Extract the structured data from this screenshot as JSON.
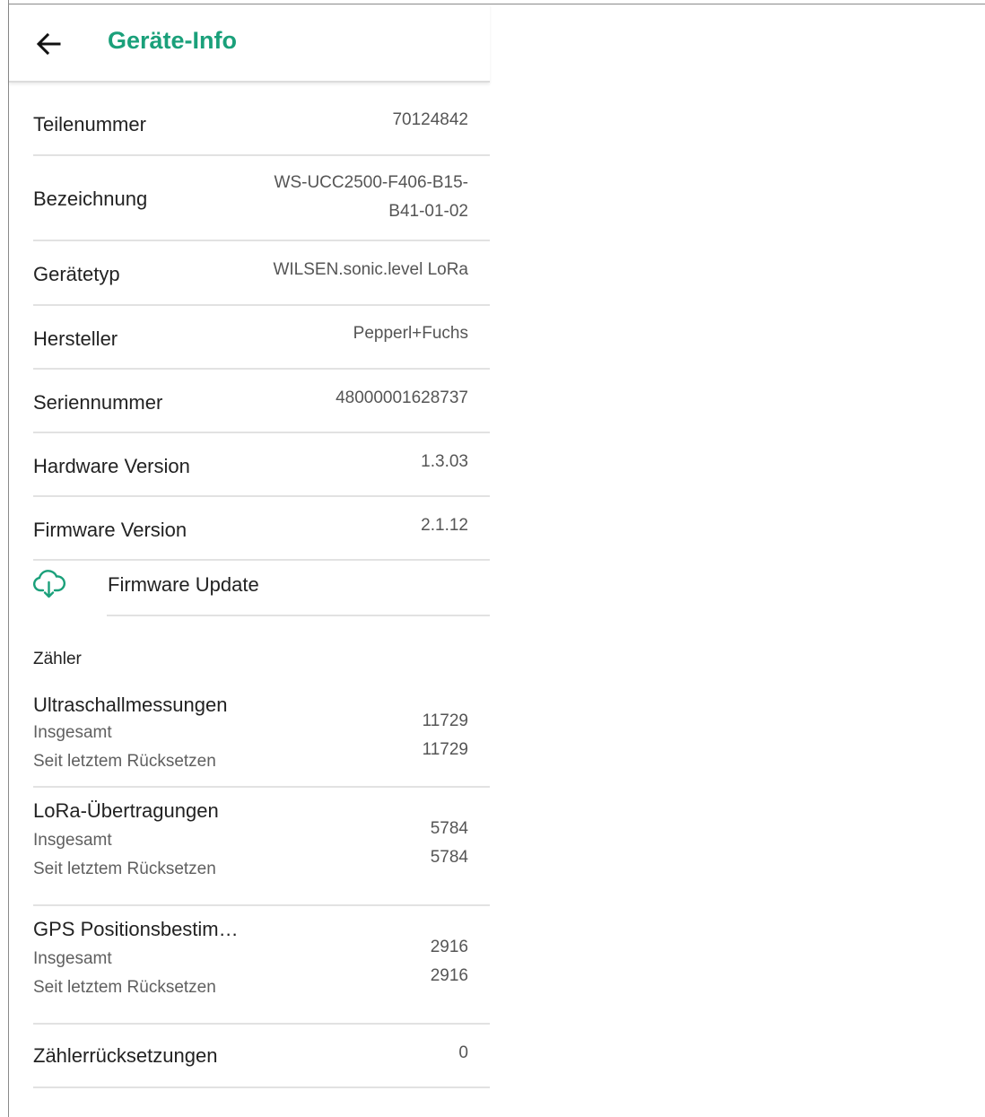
{
  "appbar": {
    "title": "Geräte-Info",
    "back_icon": "arrow-left-icon",
    "accent_color": "#1aa07a"
  },
  "info_rows": [
    {
      "label": "Teilenummer",
      "value_line1": "70124842",
      "value_line2": ""
    },
    {
      "label": "Bezeichnung",
      "value_line1": "WS-UCC2500-F406-B15-",
      "value_line2": "B41-01-02"
    },
    {
      "label": "Gerätetyp",
      "value_line1": "WILSEN.sonic.level LoRa",
      "value_line2": ""
    },
    {
      "label": "Hersteller",
      "value_line1": "Pepperl+Fuchs",
      "value_line2": ""
    },
    {
      "label": "Seriennummer",
      "value_line1": "48000001628737",
      "value_line2": ""
    },
    {
      "label": "Hardware Version",
      "value_line1": "1.3.03",
      "value_line2": ""
    },
    {
      "label": "Firmware Version",
      "value_line1": "2.1.12",
      "value_line2": ""
    }
  ],
  "firmware_update": {
    "label": "Firmware Update",
    "icon": "cloud-download-icon"
  },
  "counters": {
    "section_title": "Zähler",
    "items": [
      {
        "title": "Ultraschallmessungen",
        "total_label": "Insgesamt",
        "reset_label": "Seit letztem Rücksetzen",
        "total": "11729",
        "since_reset": "11729"
      },
      {
        "title": "LoRa-Übertragungen",
        "total_label": "Insgesamt",
        "reset_label": "Seit letztem Rücksetzen",
        "total": "5784",
        "since_reset": "5784"
      },
      {
        "title": "GPS Positionsbestim…",
        "total_label": "Insgesamt",
        "reset_label": "Seit letztem Rücksetzen",
        "total": "2916",
        "since_reset": "2916"
      }
    ],
    "reset_count": {
      "label": "Zählerrücksetzungen",
      "value": "0"
    }
  }
}
